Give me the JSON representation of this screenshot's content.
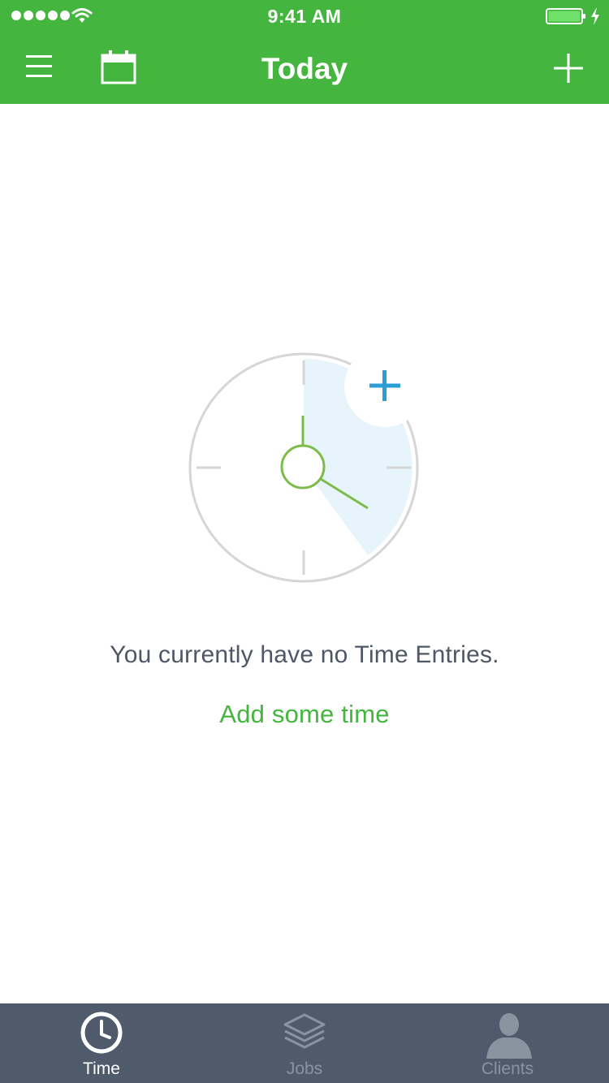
{
  "status_bar": {
    "time": "9:41 AM"
  },
  "nav": {
    "title": "Today"
  },
  "empty_state": {
    "message": "You currently have no Time Entries.",
    "link": "Add some time"
  },
  "tabs": [
    {
      "label": "Time",
      "icon": "clock-icon",
      "active": true
    },
    {
      "label": "Jobs",
      "icon": "layers-icon",
      "active": false
    },
    {
      "label": "Clients",
      "icon": "person-icon",
      "active": false
    }
  ],
  "colors": {
    "brand_green": "#44b53f",
    "tab_bar": "#4f5b6a",
    "accent_blue": "#2a9fd6",
    "text_dark": "#4d5766"
  }
}
